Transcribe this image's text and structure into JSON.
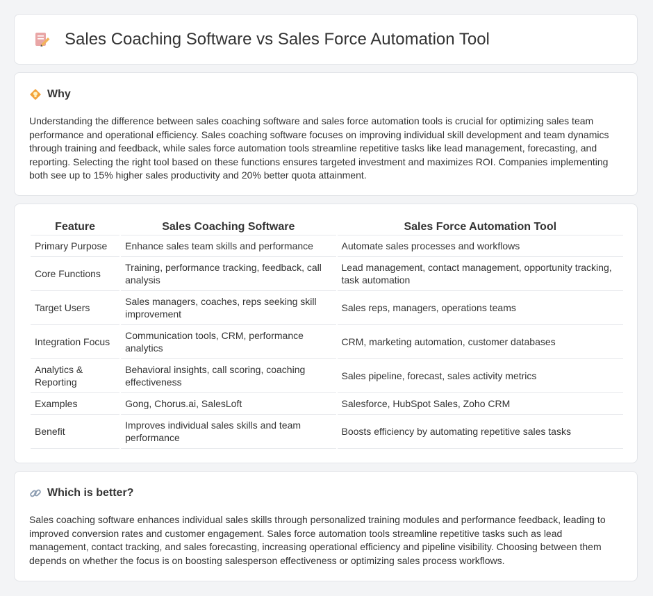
{
  "header": {
    "title": "Sales Coaching Software vs Sales Force Automation Tool",
    "icon": "edit-document-icon"
  },
  "why": {
    "title": "Why",
    "icon": "lightbulb-icon",
    "body": "Understanding the difference between sales coaching software and sales force automation tools is crucial for optimizing sales team performance and operational efficiency. Sales coaching software focuses on improving individual skill development and team dynamics through training and feedback, while sales force automation tools streamline repetitive tasks like lead management, forecasting, and reporting. Selecting the right tool based on these functions ensures targeted investment and maximizes ROI. Companies implementing both see up to 15% higher sales productivity and 20% better quota attainment."
  },
  "table": {
    "headers": [
      "Feature",
      "Sales Coaching Software",
      "Sales Force Automation Tool"
    ],
    "rows": [
      [
        "Primary Purpose",
        "Enhance sales team skills and performance",
        "Automate sales processes and workflows"
      ],
      [
        "Core Functions",
        "Training, performance tracking, feedback, call analysis",
        "Lead management, contact management, opportunity tracking, task automation"
      ],
      [
        "Target Users",
        "Sales managers, coaches, reps seeking skill improvement",
        "Sales reps, managers, operations teams"
      ],
      [
        "Integration Focus",
        "Communication tools, CRM, performance analytics",
        "CRM, marketing automation, customer databases"
      ],
      [
        "Analytics & Reporting",
        "Behavioral insights, call scoring, coaching effectiveness",
        "Sales pipeline, forecast, sales activity metrics"
      ],
      [
        "Examples",
        "Gong, Chorus.ai, SalesLoft",
        "Salesforce, HubSpot Sales, Zoho CRM"
      ],
      [
        "Benefit",
        "Improves individual sales skills and team performance",
        "Boosts efficiency by automating repetitive sales tasks"
      ]
    ]
  },
  "better": {
    "title": "Which is better?",
    "icon": "link-icon",
    "body": "Sales coaching software enhances individual sales skills through personalized training modules and performance feedback, leading to improved conversion rates and customer engagement. Sales force automation tools streamline repetitive tasks such as lead management, contact tracking, and sales forecasting, increasing operational efficiency and pipeline visibility. Choosing between them depends on whether the focus is on boosting salesperson effectiveness or optimizing sales process workflows."
  }
}
